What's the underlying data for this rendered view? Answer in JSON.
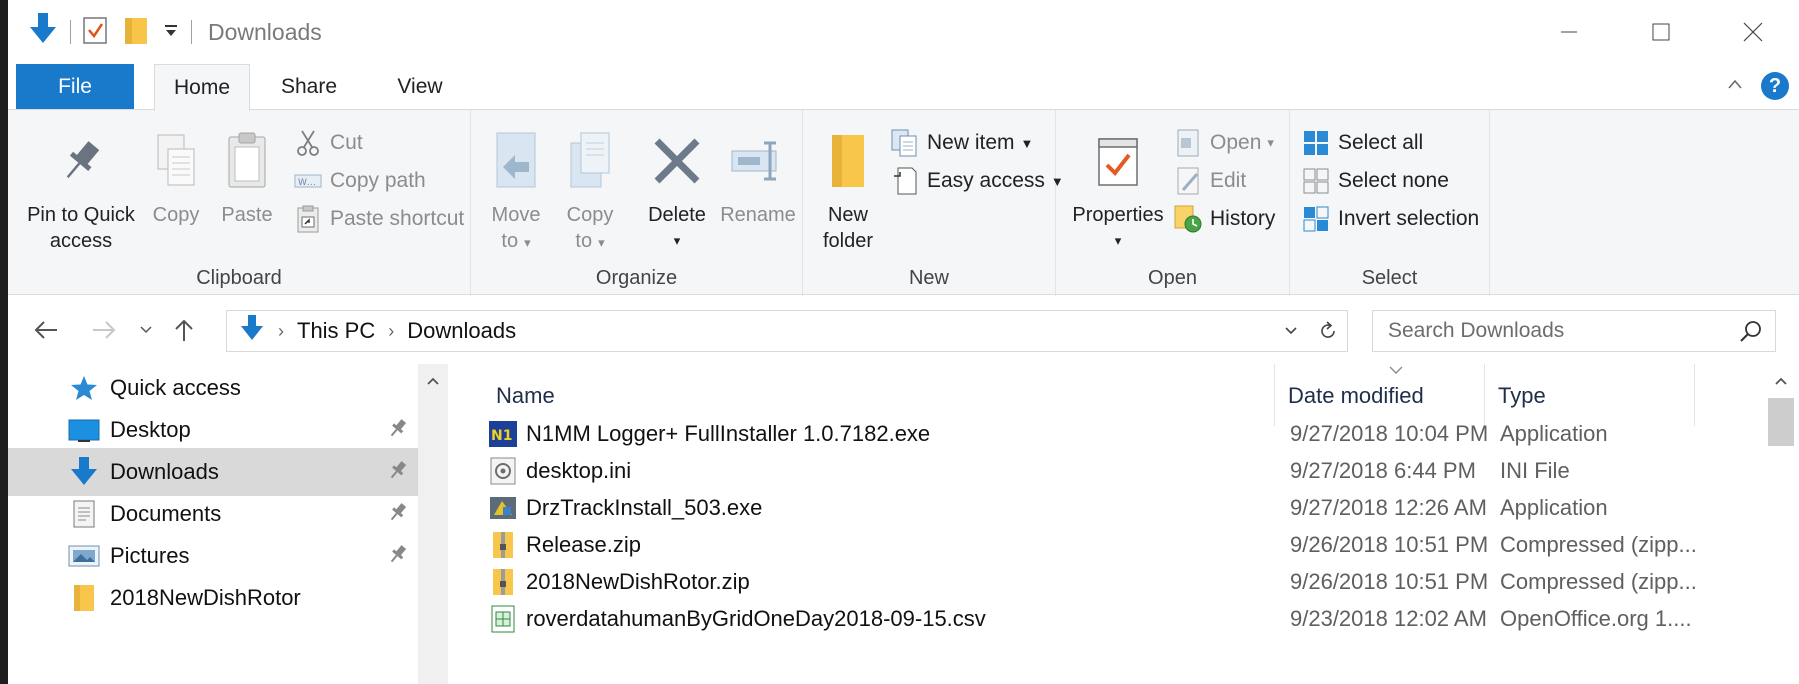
{
  "window": {
    "title": "Downloads"
  },
  "ribbon_tabs": {
    "file": "File",
    "home": "Home",
    "share": "Share",
    "view": "View"
  },
  "clipboard": {
    "pin_line1": "Pin to Quick",
    "pin_line2": "access",
    "copy": "Copy",
    "paste": "Paste",
    "cut": "Cut",
    "copy_path": "Copy path",
    "paste_shortcut": "Paste shortcut",
    "label": "Clipboard"
  },
  "organize": {
    "move_line1": "Move",
    "move_line2": "to",
    "copy_line1": "Copy",
    "copy_line2": "to",
    "delete": "Delete",
    "rename": "Rename",
    "label": "Organize"
  },
  "new": {
    "folder_line1": "New",
    "folder_line2": "folder",
    "new_item": "New item",
    "easy_access": "Easy access",
    "label": "New"
  },
  "open": {
    "properties": "Properties",
    "open": "Open",
    "edit": "Edit",
    "history": "History",
    "label": "Open"
  },
  "select": {
    "select_all": "Select all",
    "select_none": "Select none",
    "invert": "Invert selection",
    "label": "Select"
  },
  "address": {
    "crumbs": [
      "This PC",
      "Downloads"
    ],
    "search_placeholder": "Search Downloads"
  },
  "nav_pane": {
    "items": [
      {
        "label": "Quick access",
        "icon": "star-icon"
      },
      {
        "label": "Desktop",
        "icon": "desktop-icon"
      },
      {
        "label": "Downloads",
        "icon": "download-arrow-icon"
      },
      {
        "label": "Documents",
        "icon": "document-icon"
      },
      {
        "label": "Pictures",
        "icon": "pictures-icon"
      },
      {
        "label": "2018NewDishRotor",
        "icon": "folder-icon"
      }
    ]
  },
  "file_list": {
    "columns": [
      "Name",
      "Date modified",
      "Type"
    ],
    "rows": [
      {
        "name": "N1MM Logger+ FullInstaller 1.0.7182.exe",
        "date": "9/27/2018 10:04 PM",
        "type": "Application",
        "icon": "n1mm-app-icon"
      },
      {
        "name": "desktop.ini",
        "date": "9/27/2018 6:44 PM",
        "type": "INI File",
        "icon": "settings-file-icon"
      },
      {
        "name": "DrzTrackInstall_503.exe",
        "date": "9/27/2018 12:26 AM",
        "type": "Application",
        "icon": "installer-icon"
      },
      {
        "name": "Release.zip",
        "date": "9/26/2018 10:51 PM",
        "type": "Compressed (zipp...",
        "icon": "zip-folder-icon"
      },
      {
        "name": "2018NewDishRotor.zip",
        "date": "9/26/2018 10:51 PM",
        "type": "Compressed (zipp...",
        "icon": "zip-folder-icon"
      },
      {
        "name": "roverdatahumanByGridOneDay2018-09-15.csv",
        "date": "9/23/2018 12:02 AM",
        "type": "OpenOffice.org 1....",
        "icon": "spreadsheet-icon"
      }
    ]
  },
  "colors": {
    "accent": "#1979ca",
    "selection": "#d9d9d9",
    "ribbon_bg": "#f5f6f7"
  }
}
